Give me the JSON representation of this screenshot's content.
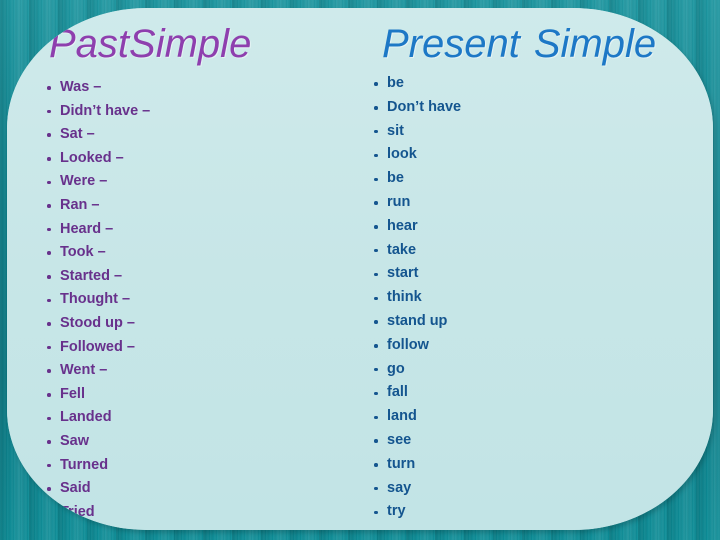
{
  "slide": {
    "background_color": "#0e8894",
    "panel_color": "#c9e7e8"
  },
  "columns": [
    {
      "id": "past-simple",
      "title_part1": "Past",
      "title_part2": "Simple",
      "title_color": "#8e3fae",
      "text_color": "#68318c",
      "items": [
        "Was –",
        "Didn’t have –",
        "Sat –",
        "Looked –",
        "Were –",
        "Ran –",
        "Heard –",
        "Took –",
        "Started –",
        "Thought –",
        "Stood up –",
        "Followed –",
        "Went –",
        "Fell",
        "Landed",
        "Saw",
        "Turned",
        "Said",
        "Tried"
      ]
    },
    {
      "id": "present-simple",
      "title_part1": "Present",
      "title_part2": "Simple",
      "title_color": "#1d78c6",
      "text_color": "#14558f",
      "items": [
        "be",
        "Don’t have",
        "sit",
        "look",
        "be",
        "run",
        "hear",
        "take",
        "start",
        "think",
        "stand up",
        "follow",
        "go",
        "fall",
        "land",
        "see",
        "turn",
        "say",
        "try"
      ]
    }
  ]
}
